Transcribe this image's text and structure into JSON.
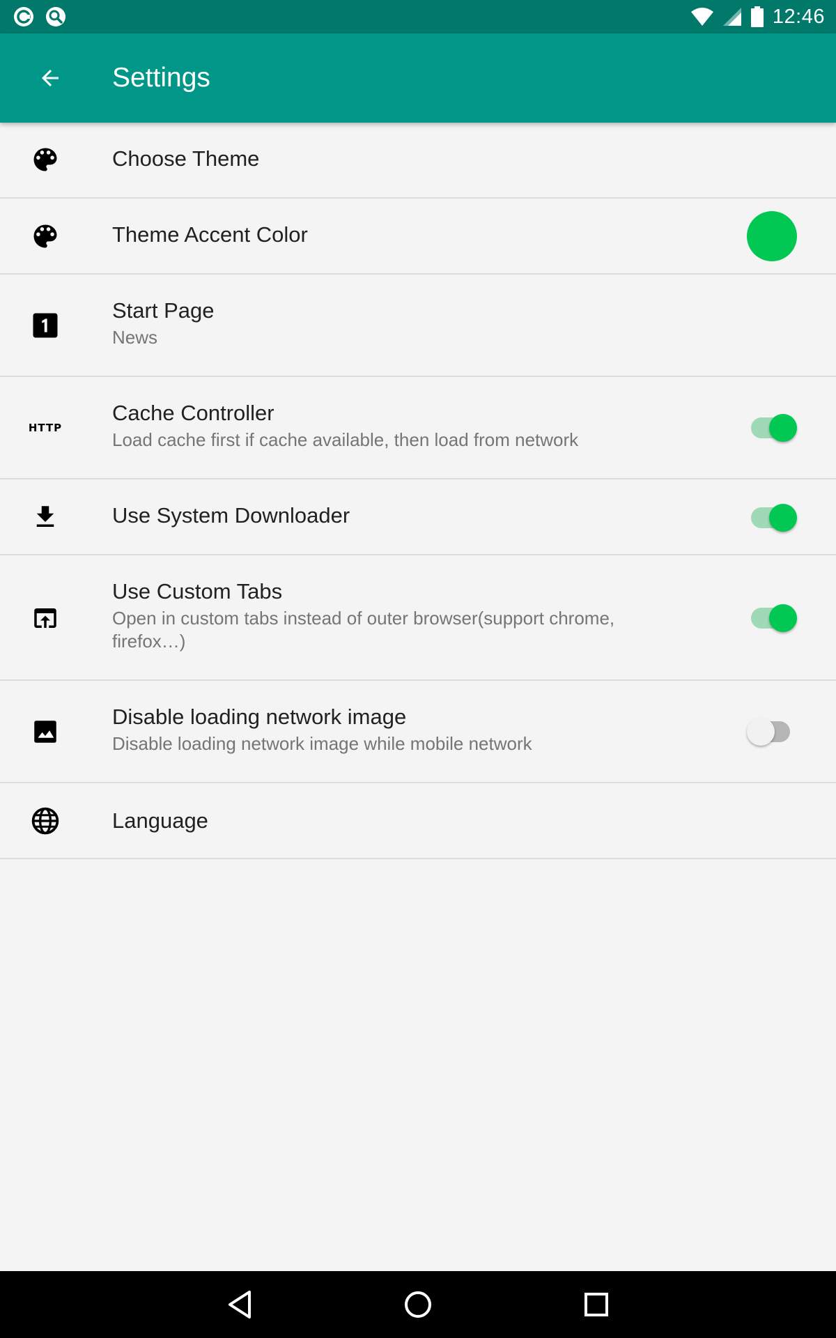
{
  "status_bar": {
    "time": "12:46",
    "left_icons": [
      "app-notification-icon",
      "search-notification-icon"
    ],
    "right_icons": [
      "wifi-icon",
      "cell-signal-icon",
      "battery-icon"
    ]
  },
  "app_bar": {
    "title": "Settings",
    "back_icon": "arrow-back-icon",
    "background_color": "#009688",
    "status_color": "#00796b"
  },
  "accent_color": "#00c853",
  "settings": [
    {
      "title": "Choose Theme",
      "summary": "",
      "icon": "palette-icon",
      "control": "none"
    },
    {
      "title": "Theme Accent Color",
      "summary": "",
      "icon": "palette-icon",
      "control": "color-swatch",
      "value": "#00c853"
    },
    {
      "title": "Start Page",
      "summary": "News",
      "icon": "looks-one-icon",
      "control": "none"
    },
    {
      "title": "Cache Controller",
      "summary": "Load cache first if cache available, then load from network",
      "icon": "http-icon",
      "control": "toggle",
      "checked": true
    },
    {
      "title": "Use System Downloader",
      "summary": "",
      "icon": "download-icon",
      "control": "toggle",
      "checked": true
    },
    {
      "title": "Use Custom Tabs",
      "summary": "Open in custom tabs instead of outer browser(support chrome, firefox…)",
      "icon": "open-in-browser-icon",
      "control": "toggle",
      "checked": true
    },
    {
      "title": "Disable loading network image",
      "summary": "Disable loading network image while mobile network",
      "icon": "image-icon",
      "control": "toggle",
      "checked": false
    },
    {
      "title": "Language",
      "summary": "",
      "icon": "globe-icon",
      "control": "none"
    }
  ],
  "nav_bar": {
    "buttons": [
      "back-triangle-icon",
      "home-circle-icon",
      "recents-square-icon"
    ]
  }
}
